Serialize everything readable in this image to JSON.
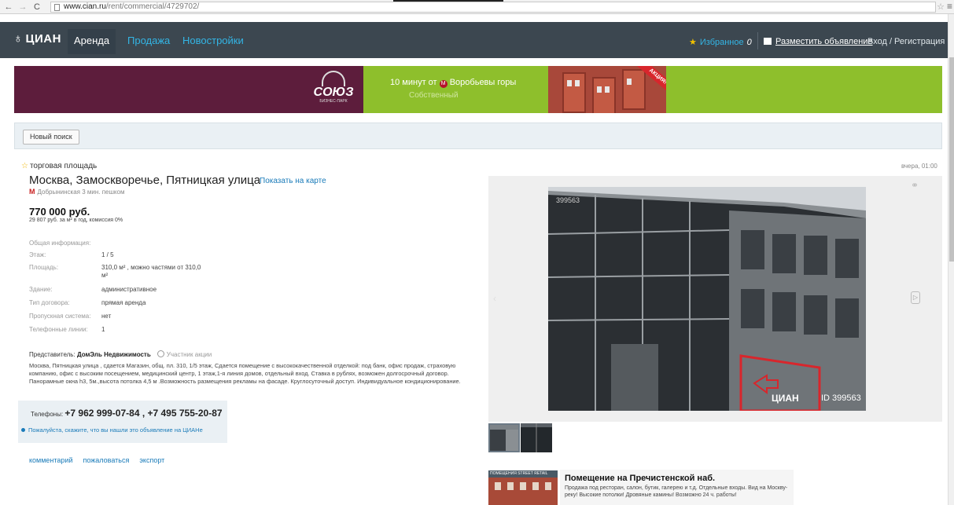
{
  "browser": {
    "back": "←",
    "forward": "→",
    "reload": "C",
    "url_host": "www.cian.ru",
    "url_path": "/rent/commercial/4729702/"
  },
  "header": {
    "logo": "ЦИАН",
    "nav": [
      "Аренда",
      "Продажа",
      "Новостройки"
    ],
    "favorites": "Избранное",
    "favorites_count": "0",
    "post_ad": "Разместить объявление",
    "login": "Вход / Регистрация"
  },
  "banner": {
    "brand": "СОЮЗ",
    "brand_sub": "БИЗНЕС-ПАРК",
    "line1": "10 минут от",
    "metro": "Воробьевы горы",
    "line2": "Собственный",
    "promo": "АКЦИЯ!"
  },
  "search": {
    "new_search": "Новый поиск"
  },
  "listing": {
    "type": "торговая площадь",
    "posted": "вчера, 01:00",
    "address": "Москва, Замоскворечье, Пятницкая улица",
    "show_map": "Показать на карте",
    "metro": "Добрынинская 3 мин. пешком",
    "price": "770 000 руб.",
    "price_sub": "29 807 руб. за м² в год, комиссия 0%",
    "info_head": "Общая информация:",
    "info": [
      {
        "label": "Этаж:",
        "value": "1 / 5"
      },
      {
        "label": "Площадь:",
        "value": "310,0 м² , можно частями от 310,0 м²"
      },
      {
        "label": "Здание:",
        "value": "административное"
      },
      {
        "label": "Тип договора:",
        "value": "прямая аренда"
      },
      {
        "label": "Пропускная система:",
        "value": "нет"
      },
      {
        "label": "Телефонные линии:",
        "value": "1"
      }
    ],
    "rep_label": "Представитель:",
    "rep_name": "ДомЭль Недвижимость",
    "rep_badge": "Участник акции",
    "description": "Москва, Пятницкая улица , сдается Магазин, общ. пл. 310, 1/5 этаж, Сдается помещение с высококачественной отделкой: под банк, офис продаж, страховую компанию, офис с высоким посещением, медицинский центр, 1 этаж,1-я линия домов, отдельный вход. Ставка в рублях, возможен долгосрочный договор. Панорамные окна h3, 5м.,высота потолка 4,5 м .Возможность размещения рекламы на фасаде. Круглосуточный доступ. Индивидуальное кондиционирование.",
    "phones_label": "Телефоны:",
    "phones": "+7 962 999-07-84 , +7 495 755-20-87",
    "cian_note": "Пожалуйста, скажите, что вы нашли это объявление на ЦИАНе",
    "actions": [
      "комментарий",
      "пожаловаться",
      "экспорт"
    ]
  },
  "photo": {
    "watermark_id": "399563",
    "cian_wm": "ЦИАН",
    "cian_id": "ID 399563"
  },
  "ad": {
    "tag": "ПОМЕЩЕНИЯ STREET RETAIL",
    "title": "Помещение на Пречистенской наб.",
    "text": "Продажа под ресторан, салон, бутик, галерею и т.д. Отдельные входы. Вид на Москву-реку! Высокие потолки! Дровяные камины! Возможно 24 ч. работы!"
  }
}
